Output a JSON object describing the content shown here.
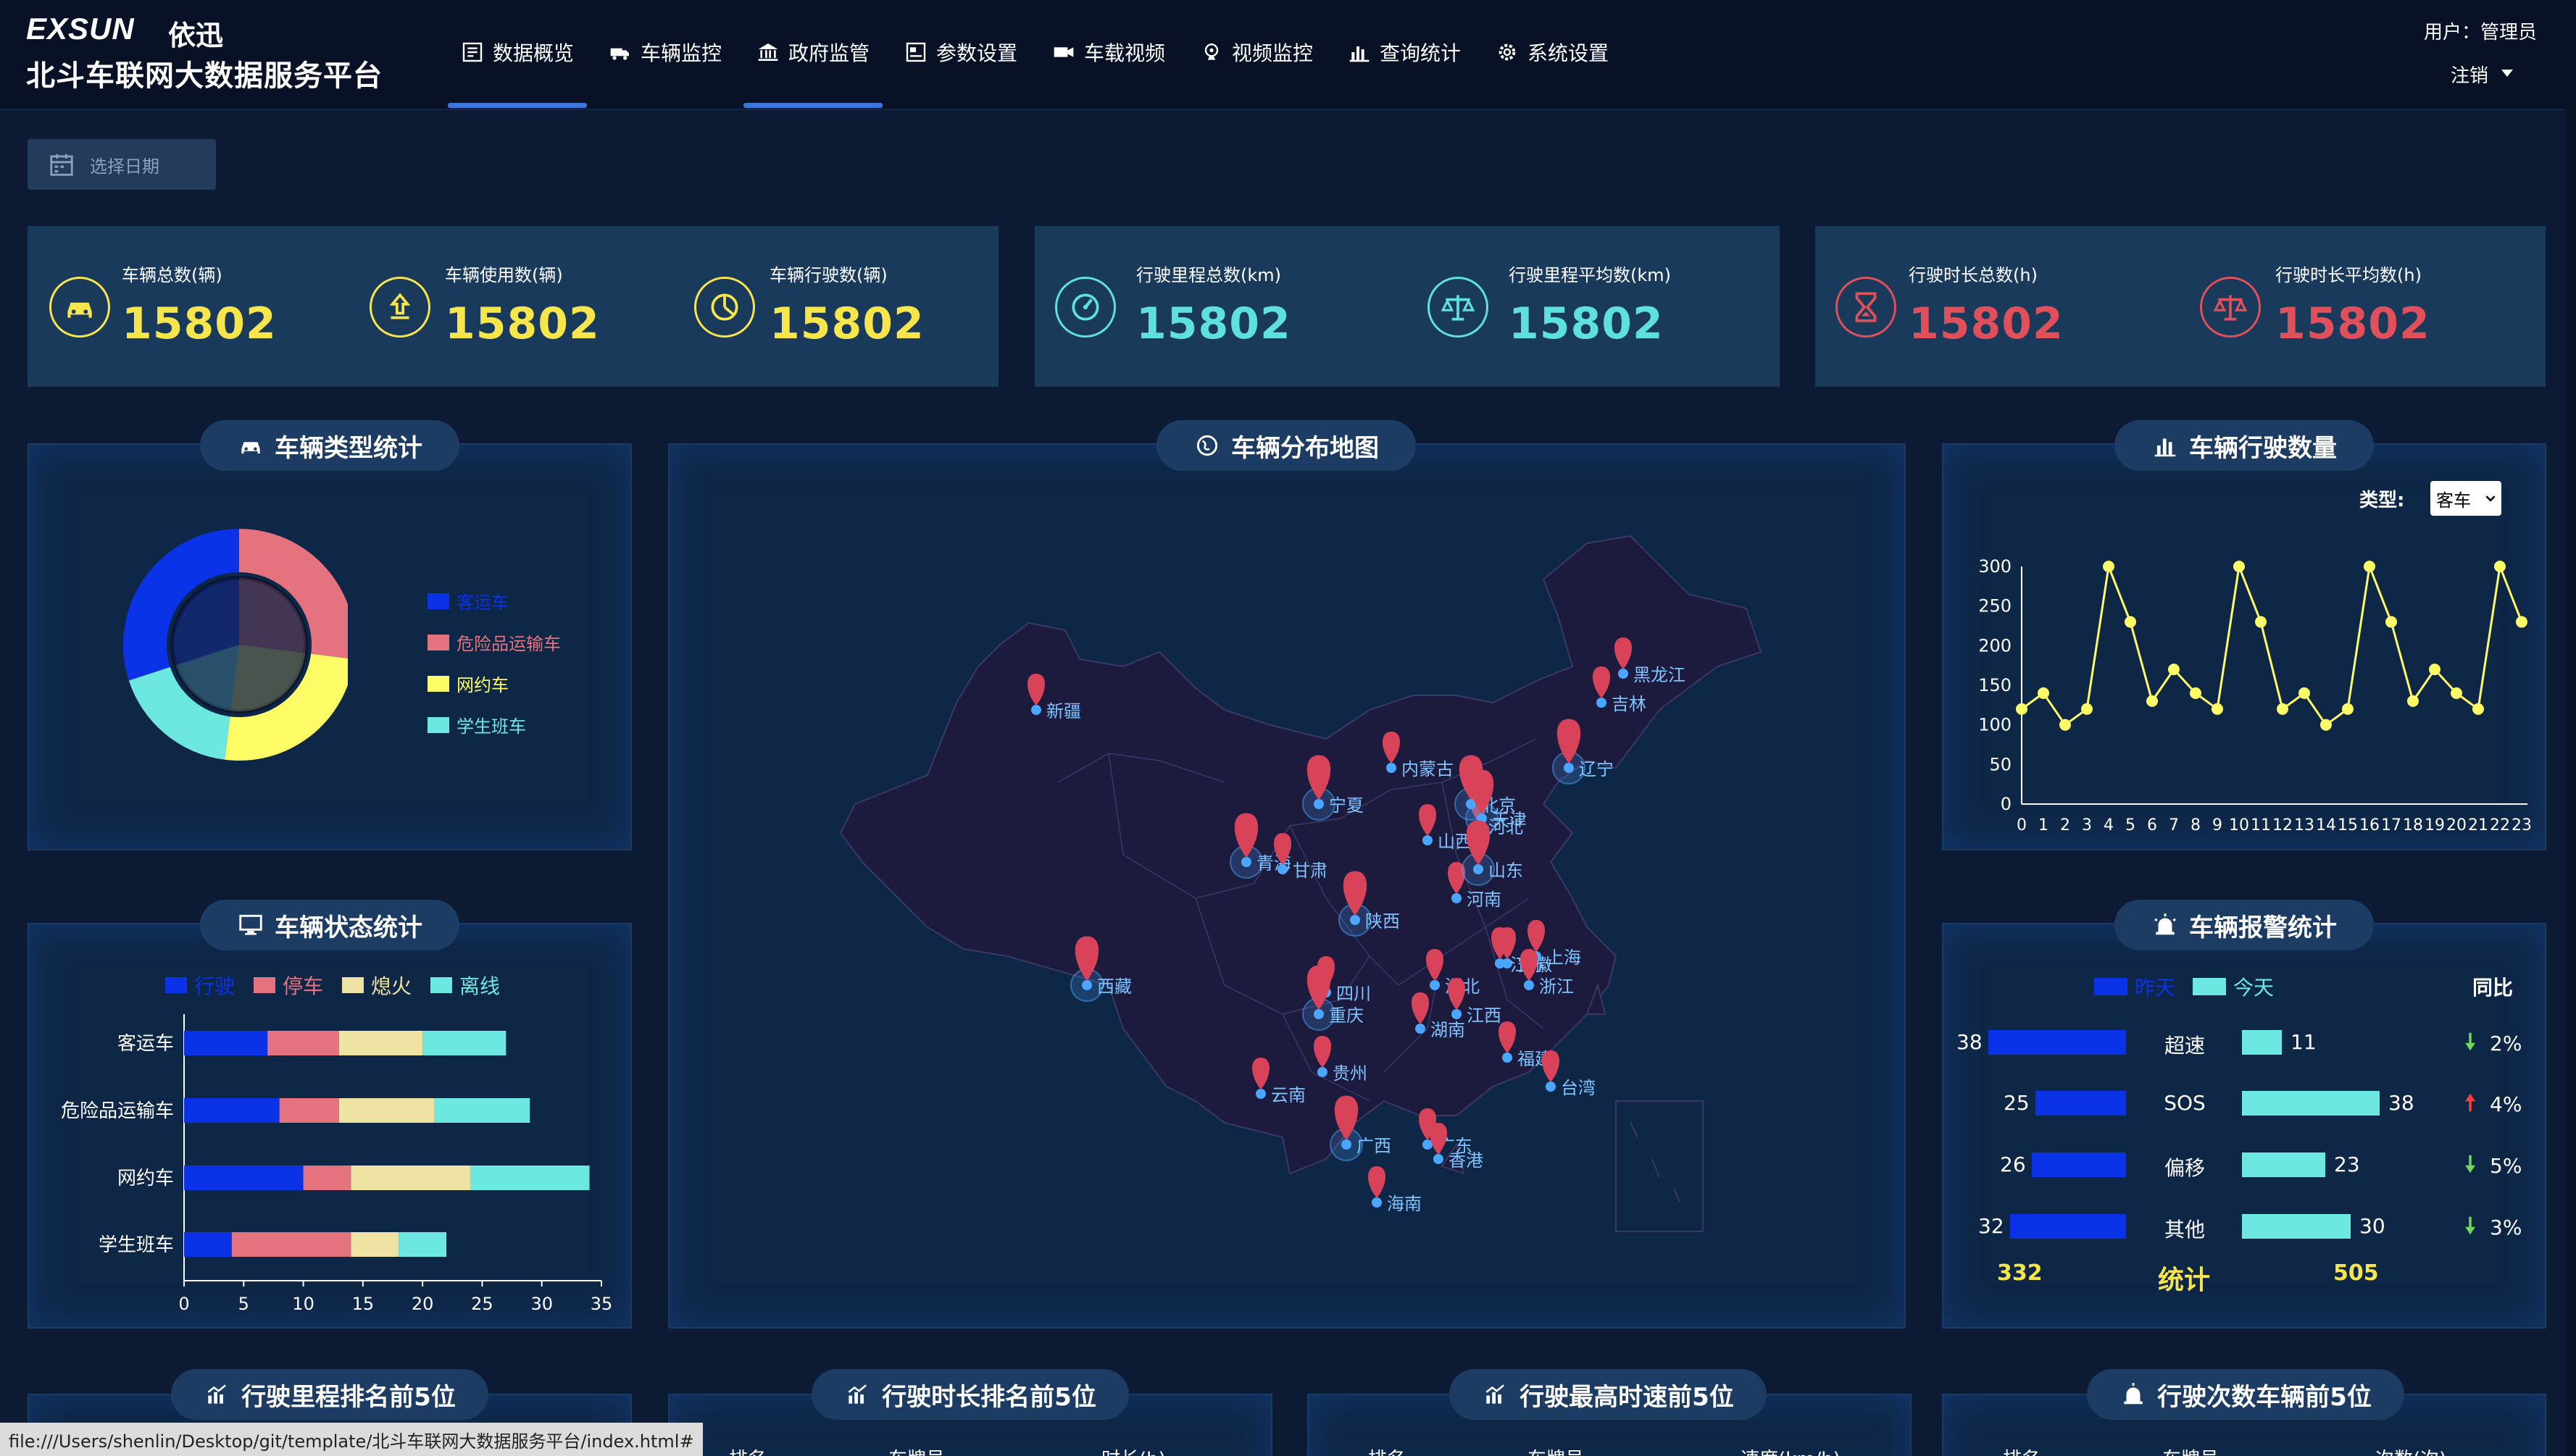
{
  "header": {
    "logo_mark": "EXSUN",
    "logo_cn": "依迅",
    "platform_title": "北斗车联网大数据服务平台",
    "user_label": "用户：管理员",
    "logout_label": "注销"
  },
  "nav": {
    "items": [
      {
        "label": "数据概览",
        "icon": "dashboard-icon"
      },
      {
        "label": "车辆监控",
        "icon": "truck-icon"
      },
      {
        "label": "政府监管",
        "icon": "government-icon"
      },
      {
        "label": "参数设置",
        "icon": "settings-form-icon"
      },
      {
        "label": "车载视频",
        "icon": "video-camera-icon"
      },
      {
        "label": "视频监控",
        "icon": "surveillance-icon"
      },
      {
        "label": "查询统计",
        "icon": "bar-chart-icon"
      },
      {
        "label": "系统设置",
        "icon": "gear-icon"
      }
    ],
    "active": [
      "数据概览",
      "政府监管"
    ]
  },
  "date_picker": {
    "placeholder": "选择日期"
  },
  "kpis": [
    {
      "label": "车辆总数(辆)",
      "value": "15802",
      "color": "#f7e54c",
      "icon": "car-icon"
    },
    {
      "label": "车辆使用数(辆)",
      "value": "15802",
      "color": "#f7e54c",
      "icon": "upload-icon"
    },
    {
      "label": "车辆行驶数(辆)",
      "value": "15802",
      "color": "#f7e54c",
      "icon": "pie-icon"
    },
    {
      "label": "行驶里程总数(km)",
      "value": "15802",
      "color": "#5fe0e0",
      "icon": "speedometer-icon"
    },
    {
      "label": "行驶里程平均数(km)",
      "value": "15802",
      "color": "#5fe0e0",
      "icon": "balance-icon"
    },
    {
      "label": "行驶时长总数(h)",
      "value": "15802",
      "color": "#e0505a",
      "icon": "hourglass-icon"
    },
    {
      "label": "行驶时长平均数(h)",
      "value": "15802",
      "color": "#e0505a",
      "icon": "balance-icon"
    }
  ],
  "panels": {
    "vehicle_type": "车辆类型统计",
    "map": "车辆分布地图",
    "driving_count": "车辆行驶数量",
    "vehicle_status": "车辆状态统计",
    "alarm": "车辆报警统计",
    "mileage_rank": "行驶里程排名前5位",
    "duration_rank": "行驶时长排名前5位",
    "speed_rank": "行驶最高时速前5位",
    "trips_rank": "行驶次数车辆前5位"
  },
  "rank_tables": [
    {
      "headers": [
        "排名",
        "车牌号",
        "时长(h)"
      ]
    },
    {
      "headers": [
        "排名",
        "车牌号",
        "时长(h)"
      ]
    },
    {
      "headers": [
        "排名",
        "车牌号",
        "速度(km/h)"
      ]
    },
    {
      "headers": [
        "排名",
        "车牌号",
        "次数(次)"
      ]
    }
  ],
  "colors": {
    "blue": "#0a32e6",
    "pink": "#e5737f",
    "yellow": "#fdfb66",
    "cyan": "#6ce8e0",
    "beige": "#efe3a3"
  },
  "driving_filter": {
    "label": "类型:",
    "value": "客车"
  },
  "map": {
    "cities": [
      {
        "name": "新疆",
        "big": false
      },
      {
        "name": "西藏",
        "big": true
      },
      {
        "name": "青海",
        "big": true
      },
      {
        "name": "甘肃",
        "big": false
      },
      {
        "name": "宁夏",
        "big": true
      },
      {
        "name": "陕西",
        "big": true
      },
      {
        "name": "四川",
        "big": false
      },
      {
        "name": "重庆",
        "big": true
      },
      {
        "name": "云南",
        "big": false
      },
      {
        "name": "贵州",
        "big": false
      },
      {
        "name": "广西",
        "big": true
      },
      {
        "name": "广东",
        "big": false
      },
      {
        "name": "香港",
        "big": false
      },
      {
        "name": "海南",
        "big": false
      },
      {
        "name": "湖南",
        "big": false
      },
      {
        "name": "湖北",
        "big": false
      },
      {
        "name": "河南",
        "big": false
      },
      {
        "name": "山西",
        "big": false
      },
      {
        "name": "河北",
        "big": false
      },
      {
        "name": "北京",
        "big": true
      },
      {
        "name": "天津",
        "big": true
      },
      {
        "name": "山东",
        "big": true
      },
      {
        "name": "内蒙古",
        "big": false
      },
      {
        "name": "辽宁",
        "big": true
      },
      {
        "name": "吉林",
        "big": false
      },
      {
        "name": "黑龙江",
        "big": false
      },
      {
        "name": "江西",
        "big": false
      },
      {
        "name": "安徽",
        "big": false
      },
      {
        "name": "江苏",
        "big": false
      },
      {
        "name": "上海",
        "big": false
      },
      {
        "name": "浙江",
        "big": false
      },
      {
        "name": "福建",
        "big": false
      },
      {
        "name": "台湾",
        "big": false
      }
    ]
  },
  "alarm": {
    "legend": [
      "昨天",
      "今天"
    ],
    "yoy_label": "同比",
    "rows": [
      {
        "name": "超速",
        "yesterday": 38,
        "today": 11,
        "trend": "down",
        "pct": "2%"
      },
      {
        "name": "SOS",
        "yesterday": 25,
        "today": 38,
        "trend": "up",
        "pct": "4%"
      },
      {
        "name": "偏移",
        "yesterday": 26,
        "today": 23,
        "trend": "down",
        "pct": "5%"
      },
      {
        "name": "其他",
        "yesterday": 32,
        "today": 30,
        "trend": "down",
        "pct": "3%"
      }
    ],
    "total_label": "统计",
    "total_yesterday": "332",
    "total_today": "505"
  },
  "status_bar": {
    "url": "file:///Users/shenlin/Desktop/git/template/北斗车联网大数据服务平台/index.html#"
  },
  "chart_data": [
    {
      "type": "pie",
      "title": "",
      "legend": [
        "客运车",
        "危险品运输车",
        "网约车",
        "学生班车"
      ],
      "colors": [
        "#0a32e6",
        "#e5737f",
        "#fdfb66",
        "#6ce8e0"
      ],
      "values": [
        30,
        27,
        25,
        18
      ]
    },
    {
      "type": "line",
      "title": "",
      "x": [
        "0",
        "1",
        "2",
        "3",
        "4",
        "5",
        "6",
        "7",
        "8",
        "9",
        "10",
        "11",
        "12",
        "13",
        "14",
        "15",
        "16",
        "17",
        "18",
        "19",
        "20",
        "21",
        "22",
        "23"
      ],
      "values": [
        120,
        140,
        100,
        120,
        300,
        230,
        130,
        170,
        140,
        120,
        300,
        230,
        120,
        140,
        100,
        120,
        300,
        230,
        130,
        170,
        140,
        120,
        300,
        230
      ],
      "ylim": [
        0,
        300
      ],
      "yticks": [
        0,
        50,
        100,
        150,
        200,
        250,
        300
      ],
      "color": "#fdfb66"
    },
    {
      "type": "bar",
      "orientation": "horizontal-stacked",
      "categories": [
        "客运车",
        "危险品运输车",
        "网约车",
        "学生班车"
      ],
      "series": [
        {
          "name": "行驶",
          "color": "#0a32e6",
          "values": [
            7,
            8,
            10,
            4
          ]
        },
        {
          "name": "停车",
          "color": "#e5737f",
          "values": [
            6,
            5,
            4,
            10
          ]
        },
        {
          "name": "熄火",
          "color": "#efe3a3",
          "values": [
            7,
            8,
            10,
            4
          ]
        },
        {
          "name": "离线",
          "color": "#6ce8e0",
          "values": [
            7,
            8,
            10,
            4
          ]
        }
      ],
      "xlim": [
        0,
        35
      ],
      "xticks": [
        0,
        5,
        10,
        15,
        20,
        25,
        30,
        35
      ]
    }
  ]
}
